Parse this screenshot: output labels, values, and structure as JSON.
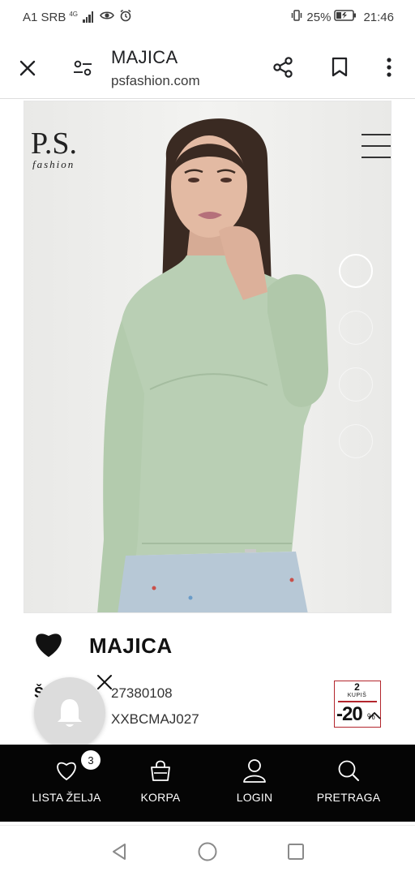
{
  "status_bar": {
    "carrier": "A1 SRB",
    "network": "4G",
    "battery_percent": "25%",
    "time": "21:46"
  },
  "browser": {
    "title": "MAJICA",
    "url": "psfashion.com",
    "icons": [
      "close-icon",
      "site-settings-icon",
      "share-icon",
      "bookmark-icon",
      "more-vert-icon"
    ]
  },
  "product_image": {
    "brand_logo_text": "P.S.",
    "brand_logo_subtext": "fashion",
    "slide_count": 4,
    "active_slide": 1
  },
  "product": {
    "name": "MAJICA",
    "sku_label": "Š",
    "sku_value": "27380108",
    "model_value": "XXBCMAJ027",
    "promo": {
      "top": "2",
      "kupis": "KUPIŠ",
      "discount": "-20",
      "percent": "%"
    }
  },
  "bottom_nav": {
    "wishlist_label": "LISTA ŽELJA",
    "wishlist_count": "3",
    "cart_label": "KORPA",
    "login_label": "LOGIN",
    "search_label": "PRETRAGA"
  },
  "colors": {
    "nav_bg": "#050505",
    "sweater_green": "#b9cfb4",
    "promo_red": "#b3262d"
  }
}
